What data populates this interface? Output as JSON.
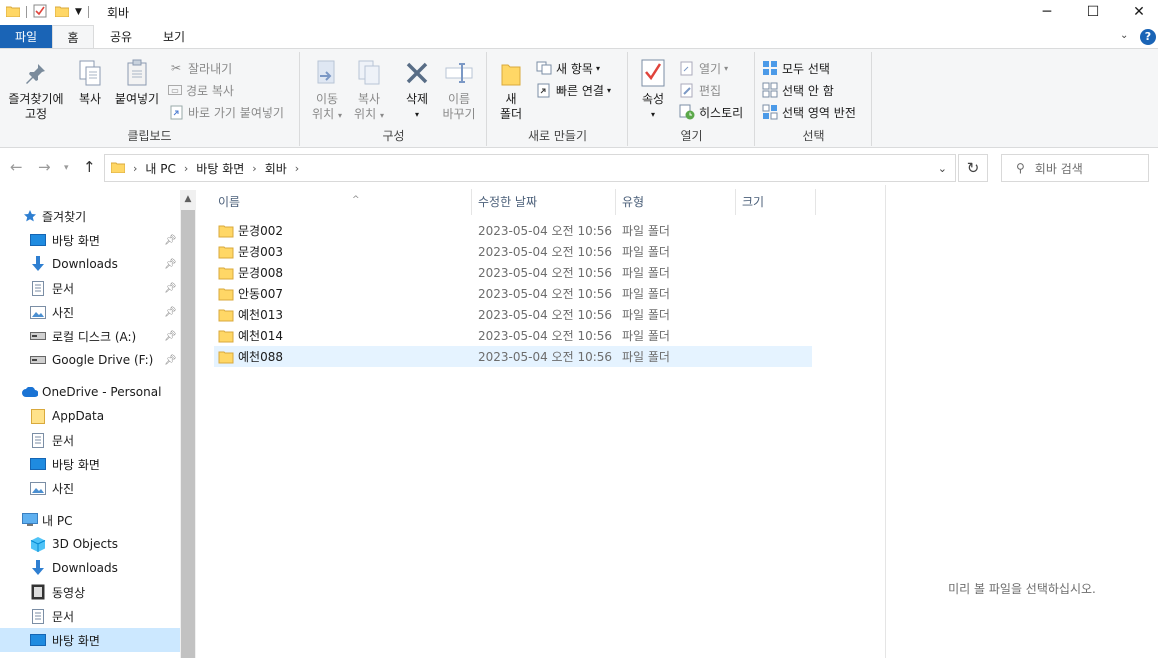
{
  "window": {
    "title": "회바",
    "minimize": "─",
    "maximize": "☐",
    "close": "✕"
  },
  "ribbon_tabs": [
    "파일",
    "홈",
    "공유",
    "보기"
  ],
  "ribbon": {
    "clipboard": {
      "label": "클립보드",
      "pin_label_1": "즐겨찾기에",
      "pin_label_2": "고정",
      "copy": "복사",
      "paste": "붙여넣기",
      "cut": "잘라내기",
      "copy_path": "경로 복사",
      "paste_shortcut": "바로 가기 붙여넣기"
    },
    "organize": {
      "label": "구성",
      "move_1": "이동",
      "move_2": "위치",
      "copyto_1": "복사",
      "copyto_2": "위치",
      "delete": "삭제",
      "rename_1": "이름",
      "rename_2": "바꾸기"
    },
    "new": {
      "label": "새로 만들기",
      "folder_1": "새",
      "folder_2": "폴더",
      "new_item": "새 항목",
      "easy_access": "빠른 연결"
    },
    "open": {
      "label": "열기",
      "properties": "속성",
      "open": "열기",
      "edit": "편집",
      "history": "히스토리"
    },
    "select": {
      "label": "선택",
      "select_all": "모두 선택",
      "select_none": "선택 안 함",
      "invert": "선택 영역 반전"
    }
  },
  "address": {
    "crumbs": [
      "내 PC",
      "바탕 화면",
      "회바"
    ],
    "search_placeholder": "회바 검색"
  },
  "nav": {
    "quick_access": "즐겨찾기",
    "quick_items": [
      {
        "label": "바탕 화면",
        "icon": "desktop-icon"
      },
      {
        "label": "Downloads",
        "icon": "download-icon"
      },
      {
        "label": "문서",
        "icon": "document-icon"
      },
      {
        "label": "사진",
        "icon": "picture-icon"
      },
      {
        "label": "로컬 디스크 (A:)",
        "icon": "drive-icon"
      },
      {
        "label": "Google Drive (F:)",
        "icon": "drive-icon"
      }
    ],
    "onedrive": "OneDrive - Personal",
    "onedrive_items": [
      {
        "label": "AppData",
        "icon": "folder-icon"
      },
      {
        "label": "문서",
        "icon": "document-icon"
      },
      {
        "label": "바탕 화면",
        "icon": "desktop-icon"
      },
      {
        "label": "사진",
        "icon": "picture-icon"
      }
    ],
    "this_pc": "내 PC",
    "pc_items": [
      {
        "label": "3D Objects",
        "icon": "cube-icon"
      },
      {
        "label": "Downloads",
        "icon": "download-icon"
      },
      {
        "label": "동영상",
        "icon": "video-icon"
      },
      {
        "label": "문서",
        "icon": "document-icon"
      },
      {
        "label": "바탕 화면",
        "icon": "desktop-icon"
      }
    ]
  },
  "columns": [
    "이름",
    "수정한 날짜",
    "유형",
    "크기"
  ],
  "files": [
    {
      "name": "문경002",
      "date": "2023-05-04 오전 10:56",
      "type": "파일 폴더"
    },
    {
      "name": "문경003",
      "date": "2023-05-04 오전 10:56",
      "type": "파일 폴더"
    },
    {
      "name": "문경008",
      "date": "2023-05-04 오전 10:56",
      "type": "파일 폴더"
    },
    {
      "name": "안동007",
      "date": "2023-05-04 오전 10:56",
      "type": "파일 폴더"
    },
    {
      "name": "예천013",
      "date": "2023-05-04 오전 10:56",
      "type": "파일 폴더"
    },
    {
      "name": "예천014",
      "date": "2023-05-04 오전 10:56",
      "type": "파일 폴더"
    },
    {
      "name": "예천088",
      "date": "2023-05-04 오전 10:56",
      "type": "파일 폴더"
    }
  ],
  "preview_text": "미리 볼 파일을 선택하십시오.",
  "colors": {
    "accent": "#1a64b6",
    "folder": "#ffd766",
    "selection": "#cce8ff"
  }
}
